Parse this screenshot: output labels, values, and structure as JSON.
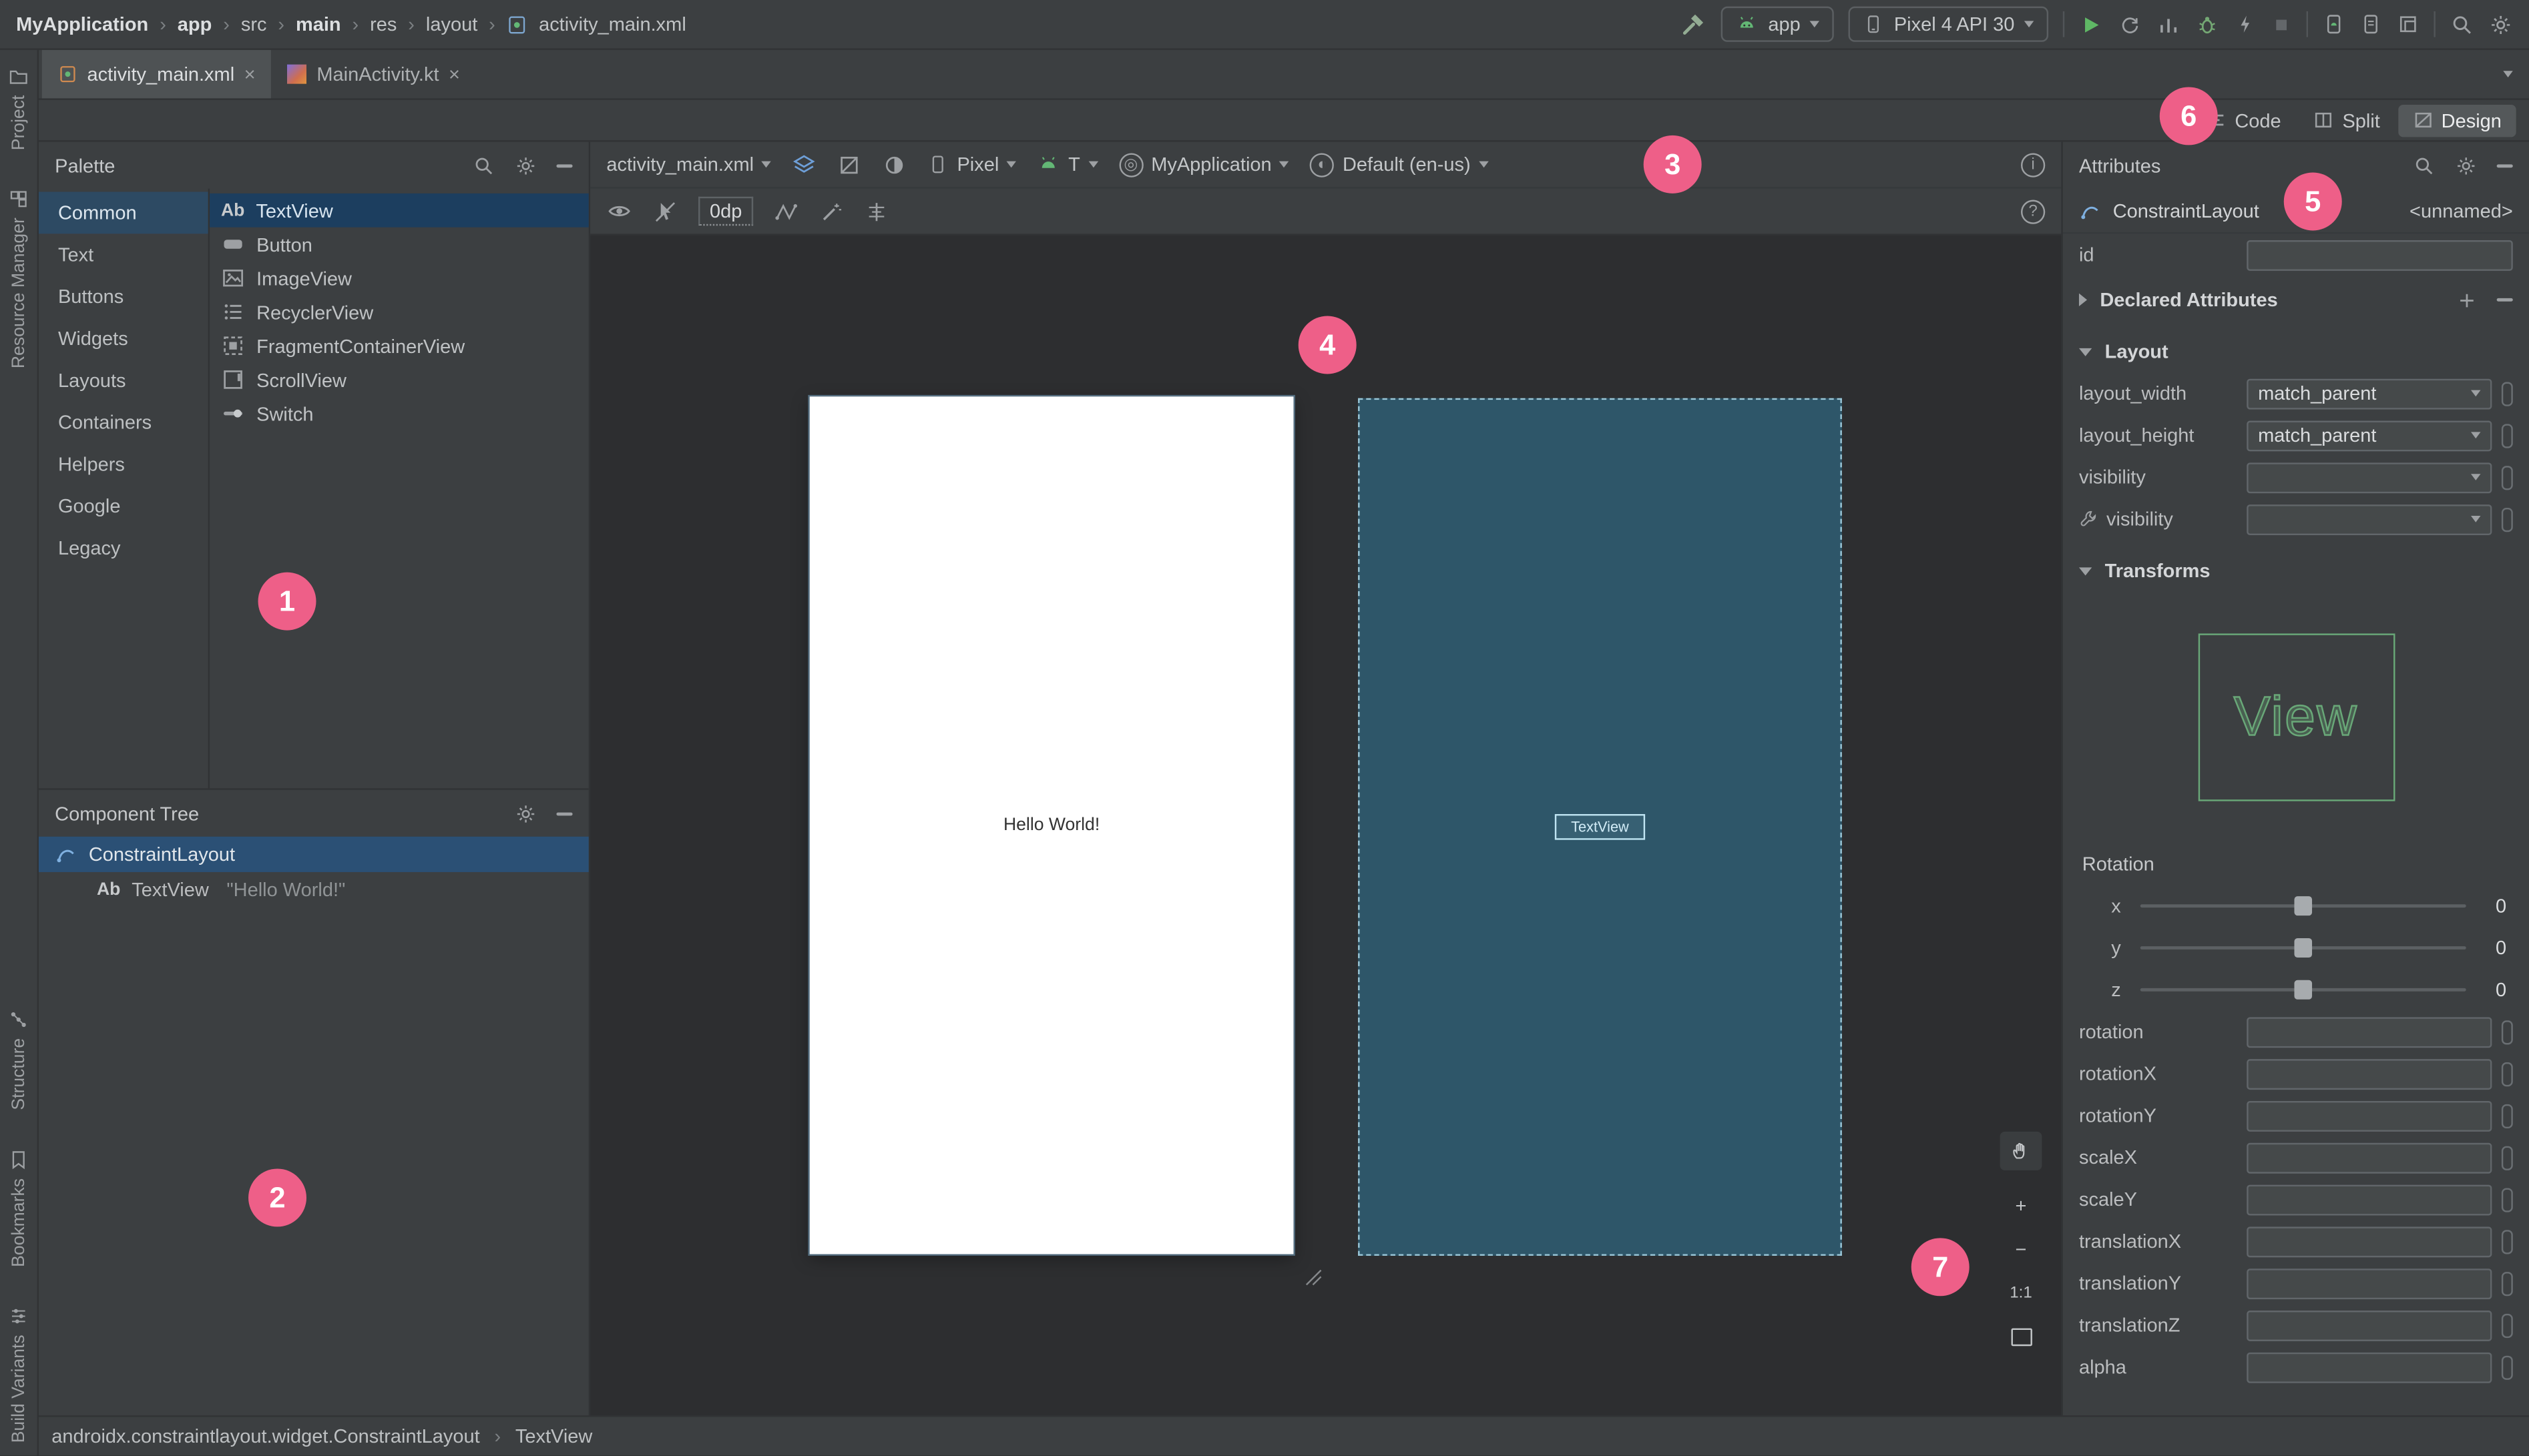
{
  "icons": {
    "close": "×",
    "chevron": "›",
    "help": "?",
    "info": "i",
    "textview_abbrev": "Ab"
  },
  "window": {
    "breadcrumbs": [
      {
        "label": "MyApplication"
      },
      {
        "label": "app"
      },
      {
        "label": "src"
      },
      {
        "label": "main"
      },
      {
        "label": "res"
      },
      {
        "label": "layout"
      },
      {
        "label": "activity_main.xml"
      }
    ],
    "run_config": "app",
    "device_selector": "Pixel 4 API 30"
  },
  "tabs": {
    "tab1": "activity_main.xml",
    "tab2": "MainActivity.kt"
  },
  "view_switcher": {
    "code": "Code",
    "split": "Split",
    "design": "Design"
  },
  "tool_strip": {
    "project": "Project",
    "resource_manager": "Resource Manager",
    "structure": "Structure",
    "bookmarks": "Bookmarks",
    "build_variants": "Build Variants"
  },
  "palette": {
    "title": "Palette",
    "categories": [
      "Common",
      "Text",
      "Buttons",
      "Widgets",
      "Layouts",
      "Containers",
      "Helpers",
      "Google",
      "Legacy"
    ],
    "components": [
      "TextView",
      "Button",
      "ImageView",
      "RecyclerView",
      "FragmentContainerView",
      "ScrollView",
      "Switch"
    ]
  },
  "component_tree": {
    "title": "Component Tree",
    "root": "ConstraintLayout",
    "child": "TextView",
    "child_value": "\"Hello World!\""
  },
  "design_toolbar": {
    "file": "activity_main.xml",
    "device": "Pixel",
    "api": "T",
    "theme": "MyApplication",
    "locale": "Default (en-us)",
    "default_margin": "0dp"
  },
  "canvas": {
    "design_text": "Hello World!",
    "blueprint_label": "TextView"
  },
  "zoom": {
    "in": "+",
    "out": "−",
    "ratio": "1:1"
  },
  "attributes": {
    "title": "Attributes",
    "component": "ConstraintLayout",
    "unnamed": "<unnamed>",
    "id_label": "id",
    "declared_section": "Declared Attributes",
    "layout_section": "Layout",
    "rows": [
      {
        "label": "layout_width",
        "value": "match_parent"
      },
      {
        "label": "layout_height",
        "value": "match_parent"
      },
      {
        "label": "visibility",
        "value": ""
      },
      {
        "label": "visibility",
        "value": ""
      }
    ],
    "transforms_section": "Transforms",
    "view_preview": "View",
    "rotation_label": "Rotation",
    "sliders": [
      {
        "axis": "x",
        "value": "0"
      },
      {
        "axis": "y",
        "value": "0"
      },
      {
        "axis": "z",
        "value": "0"
      }
    ],
    "fields": [
      "rotation",
      "rotationX",
      "rotationY",
      "scaleX",
      "scaleY",
      "translationX",
      "translationY",
      "translationZ",
      "alpha"
    ]
  },
  "status_bar": {
    "left": "androidx.constraintlayout.widget.ConstraintLayout",
    "right": "TextView"
  },
  "badges": [
    "1",
    "2",
    "3",
    "4",
    "5",
    "6",
    "7"
  ]
}
